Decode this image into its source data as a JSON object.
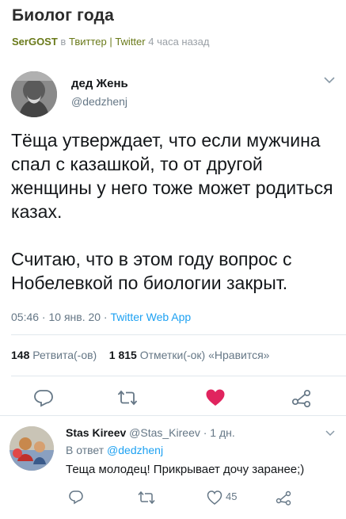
{
  "post": {
    "title": "Биолог года",
    "author": "SerGOST",
    "in_word": "в",
    "category": "Твиттер | Twitter",
    "time_ago": "4 часа назад"
  },
  "tweet": {
    "name": "дед Жень",
    "handle": "@dedzhenj",
    "text_p1": "Тёща утверждает, что если мужчина спал с казашкой, то от другой женщины у него тоже может родиться казах.",
    "text_p2": "Считаю, что в этом году вопрос с Нобелевкой по биологии закрыт.",
    "time": "05:46 · 10 янв. 20 · ",
    "source": "Twitter Web App",
    "retweets_count": "148",
    "retweets_label": "Ретвита(-ов)",
    "likes_count": "1 815",
    "likes_label": "Отметки(-ок) «Нравится»",
    "icons": {
      "reply": "reply-icon",
      "retweet": "retweet-icon",
      "like": "heart-icon-liked",
      "share": "share-icon",
      "menu": "chevron-down-icon"
    },
    "like_color": "#e0245e"
  },
  "reply": {
    "name": "Stas Kireev",
    "handle_time": "@Stas_Kireev · 1 дн.",
    "reply_to_prefix": "В ответ",
    "reply_to_handle": "@dedzhenj",
    "text": "Теща молодец! Прикрывает дочу заранее;)",
    "like_count": "45"
  },
  "colors": {
    "link": "#1da1f2",
    "muted": "#657786",
    "divider": "#e1e8ed",
    "category": "#6a7a1a"
  }
}
